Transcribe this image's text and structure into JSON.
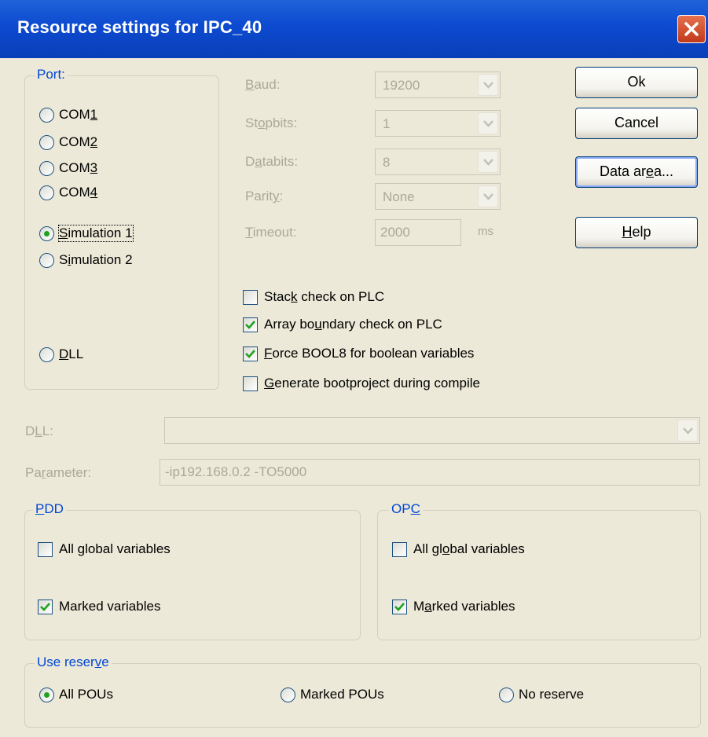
{
  "window": {
    "title": "Resource settings for IPC_40"
  },
  "port": {
    "legend": "Port:",
    "options": [
      "COM1",
      "COM2",
      "COM3",
      "COM4",
      "Simulation 1",
      "Simulation 2",
      "DLL"
    ],
    "selected": "Simulation 1"
  },
  "serial": {
    "baud_label": "Baud:",
    "baud_value": "19200",
    "stopbits_label": "Stopbits:",
    "stopbits_value": "1",
    "databits_label": "Databits:",
    "databits_value": "8",
    "parity_label": "Parity:",
    "parity_value": "None",
    "timeout_label": "Timeout:",
    "timeout_value": "2000",
    "timeout_unit": "ms"
  },
  "buttons": {
    "ok": "Ok",
    "cancel": "Cancel",
    "data_area": "Data area...",
    "help": "Help"
  },
  "options": [
    {
      "label": "Stack check on PLC",
      "checked": false
    },
    {
      "label": "Array boundary check on PLC",
      "checked": true
    },
    {
      "label": "Force BOOL8 for boolean variables",
      "checked": true
    },
    {
      "label": "Generate bootproject during compile",
      "checked": false
    }
  ],
  "dll": {
    "label": "DLL:",
    "value": ""
  },
  "parameter": {
    "label": "Parameter:",
    "value": "-ip192.168.0.2 -TO5000"
  },
  "pdd": {
    "legend": "PDD",
    "all_global": {
      "label": "All global variables",
      "checked": false
    },
    "marked": {
      "label": "Marked variables",
      "checked": true
    }
  },
  "opc": {
    "legend": "OPC",
    "all_global": {
      "label": "All global variables",
      "checked": false
    },
    "marked": {
      "label": "Marked variables",
      "checked": true
    }
  },
  "reserve": {
    "legend": "Use reserve",
    "options": [
      "All POUs",
      "Marked POUs",
      "No reserve"
    ],
    "selected": "All POUs"
  },
  "icons": {
    "close": "close-x-icon",
    "dropdown": "chevron-down-icon"
  },
  "colors": {
    "titlebar": "#0a46d0",
    "face": "#ece9d8",
    "legend": "#0046d5",
    "check": "#21a121",
    "close": "#d9532c"
  }
}
